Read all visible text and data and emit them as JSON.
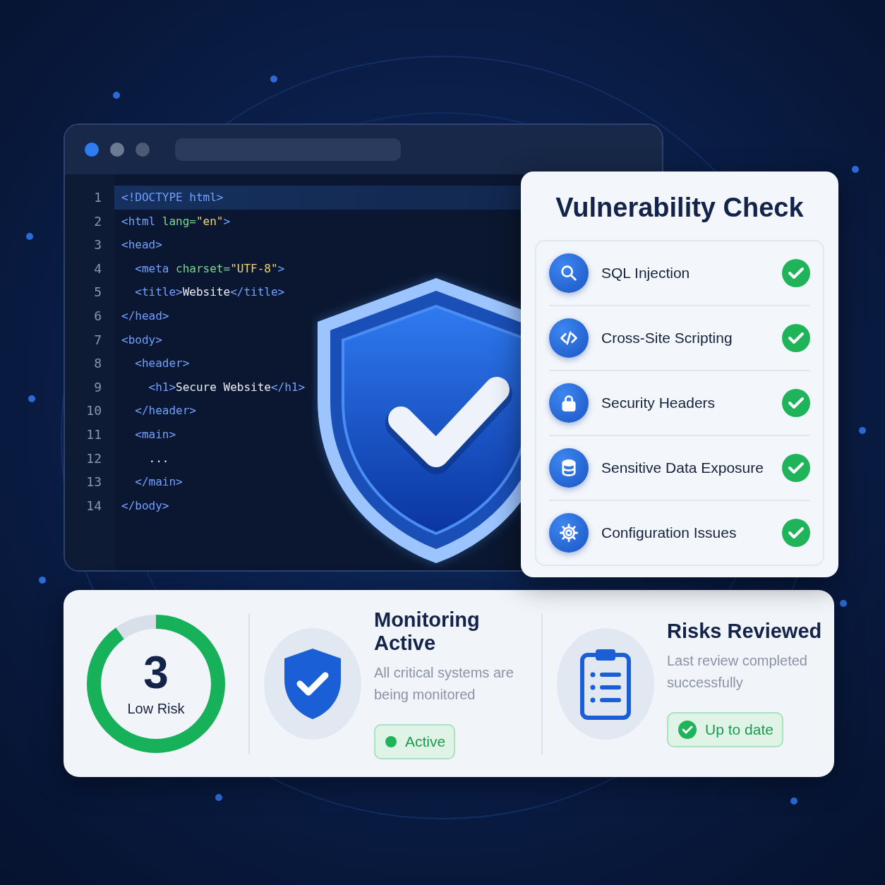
{
  "editor": {
    "lines": [
      {
        "number": "1",
        "selected": true,
        "segments": [
          {
            "kind": "tag",
            "text": "<!DOCTYPE html>"
          }
        ]
      },
      {
        "number": "2",
        "selected": false,
        "segments": [
          {
            "kind": "tag",
            "text": "<html"
          },
          {
            "kind": "attr",
            "text": " lang="
          },
          {
            "kind": "str",
            "text": "\"en\""
          },
          {
            "kind": "tag",
            "text": ">"
          }
        ]
      },
      {
        "number": "3",
        "selected": false,
        "segments": [
          {
            "kind": "tag",
            "text": "<head>"
          }
        ]
      },
      {
        "number": "4",
        "selected": false,
        "segments": [
          {
            "kind": "tag",
            "text": "  <meta"
          },
          {
            "kind": "attr",
            "text": " charset="
          },
          {
            "kind": "str",
            "text": "\"UTF-8\""
          },
          {
            "kind": "tag",
            "text": ">"
          }
        ]
      },
      {
        "number": "5",
        "selected": false,
        "segments": [
          {
            "kind": "tag",
            "text": "  <title>"
          },
          {
            "kind": "text",
            "text": "Website"
          },
          {
            "kind": "tag",
            "text": "</title>"
          }
        ]
      },
      {
        "number": "6",
        "selected": false,
        "segments": [
          {
            "kind": "tag",
            "text": "</head>"
          }
        ]
      },
      {
        "number": "7",
        "selected": false,
        "segments": [
          {
            "kind": "tag",
            "text": "<body>"
          }
        ]
      },
      {
        "number": "8",
        "selected": false,
        "segments": [
          {
            "kind": "tag",
            "text": "  <header>"
          }
        ]
      },
      {
        "number": "9",
        "selected": false,
        "segments": [
          {
            "kind": "tag",
            "text": "    <h1>"
          },
          {
            "kind": "text",
            "text": "Secure Website"
          },
          {
            "kind": "tag",
            "text": "</h1>"
          }
        ]
      },
      {
        "number": "10",
        "selected": false,
        "segments": [
          {
            "kind": "tag",
            "text": "  </header>"
          }
        ]
      },
      {
        "number": "11",
        "selected": false,
        "segments": [
          {
            "kind": "tag",
            "text": "  <main>"
          }
        ]
      },
      {
        "number": "12",
        "selected": false,
        "segments": [
          {
            "kind": "text",
            "text": "    ..."
          }
        ]
      },
      {
        "number": "13",
        "selected": false,
        "segments": [
          {
            "kind": "tag",
            "text": "  </main>"
          }
        ]
      },
      {
        "number": "14",
        "selected": false,
        "segments": [
          {
            "kind": "tag",
            "text": "</body>"
          }
        ]
      }
    ]
  },
  "vulnerability_check": {
    "title": "Vulnerability Check",
    "items": [
      {
        "kind": "search",
        "label": "SQL Injection",
        "passed": true
      },
      {
        "kind": "code",
        "label": "Cross-Site Scripting",
        "passed": true
      },
      {
        "kind": "lock",
        "label": "Security Headers",
        "passed": true
      },
      {
        "kind": "database",
        "label": "Sensitive Data Exposure",
        "passed": true
      },
      {
        "kind": "gear",
        "label": "Configuration Issues",
        "passed": true
      }
    ]
  },
  "summary": {
    "risk": {
      "value": "3",
      "label": "Low Risk",
      "level": 0.9
    },
    "cards": [
      {
        "kind": "shield",
        "title": "Monitoring Active",
        "description": "All critical systems are being monitored",
        "badge": {
          "kind": "dot",
          "label": "Active"
        }
      },
      {
        "kind": "clipboard",
        "title": "Risks Reviewed",
        "description": "Last review completed successfully",
        "badge": {
          "kind": "check",
          "label": "Up to date"
        }
      }
    ]
  }
}
